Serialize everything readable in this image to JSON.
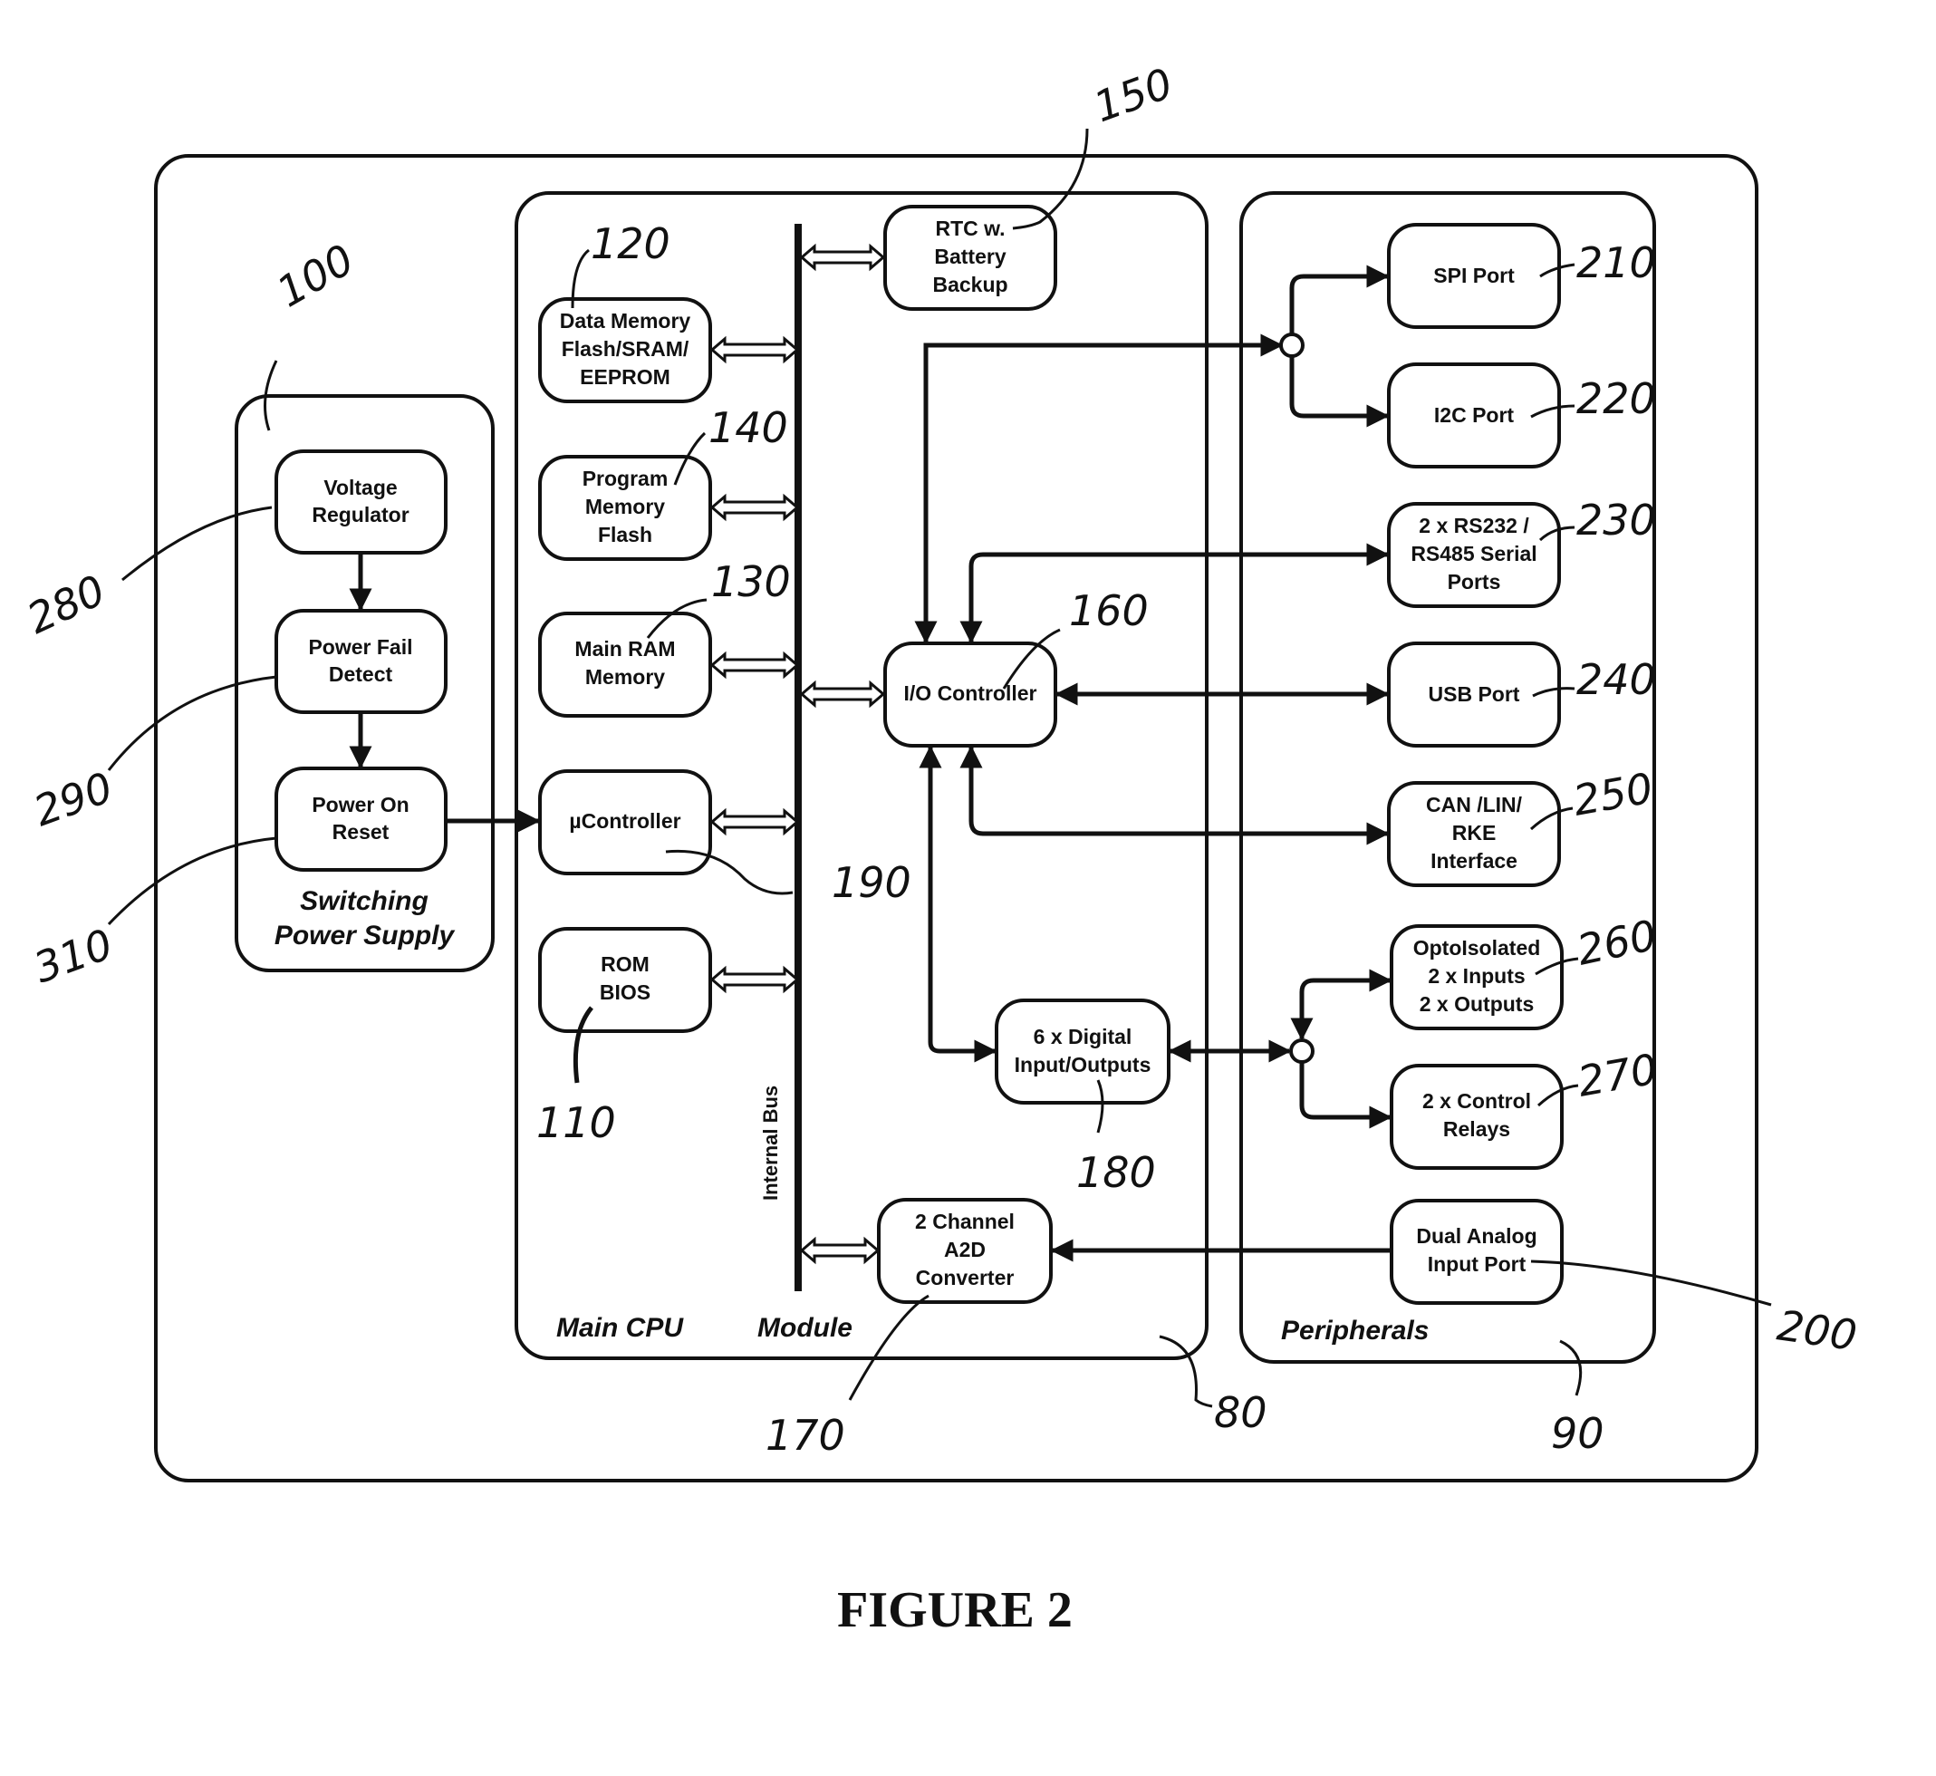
{
  "figure": {
    "caption": "FIGURE 2"
  },
  "groups": {
    "power_supply": {
      "label_line1": "Switching",
      "label_line2": "Power Supply",
      "ref": "100"
    },
    "cpu_module": {
      "label_left": "Main CPU",
      "label_right": "Module",
      "ref": "80"
    },
    "peripherals": {
      "label": "Peripherals",
      "ref": "90"
    }
  },
  "bus": {
    "label": "Internal Bus"
  },
  "blocks": {
    "voltage_regulator": {
      "lines": [
        "Voltage",
        "Regulator"
      ],
      "ref": "280"
    },
    "power_fail_detect": {
      "lines": [
        "Power Fail",
        "Detect"
      ],
      "ref": "290"
    },
    "power_on_reset": {
      "lines": [
        "Power On",
        "Reset"
      ],
      "ref": "310"
    },
    "data_memory": {
      "lines": [
        "Data Memory",
        "Flash/SRAM/",
        "EEPROM"
      ],
      "ref": "120"
    },
    "program_memory": {
      "lines": [
        "Program",
        "Memory",
        "Flash"
      ],
      "ref": "140"
    },
    "main_ram": {
      "lines": [
        "Main RAM",
        "Memory"
      ],
      "ref": "130"
    },
    "ucontroller": {
      "lines": [
        "µController"
      ],
      "ref": "190"
    },
    "rom_bios": {
      "lines": [
        "ROM",
        "BIOS"
      ],
      "ref": "110"
    },
    "rtc": {
      "lines": [
        "RTC w.",
        "Battery",
        "Backup"
      ],
      "ref": "150"
    },
    "io_controller": {
      "lines": [
        "I/O Controller"
      ],
      "ref": "160"
    },
    "digital_io": {
      "lines": [
        "6  x  Digital",
        "Input/Outputs"
      ],
      "ref": "180"
    },
    "a2d": {
      "lines": [
        "2 Channel",
        "A2D",
        "Converter"
      ],
      "ref": "170"
    },
    "spi": {
      "lines": [
        "SPI Port"
      ],
      "ref": "210"
    },
    "i2c": {
      "lines": [
        "I2C Port"
      ],
      "ref": "220"
    },
    "serial": {
      "lines": [
        "2 x RS232 /",
        "RS485 Serial",
        "Ports"
      ],
      "ref": "230"
    },
    "usb": {
      "lines": [
        "USB Port"
      ],
      "ref": "240"
    },
    "can": {
      "lines": [
        "CAN /LIN/",
        "RKE",
        "Interface"
      ],
      "ref": "250"
    },
    "opto": {
      "lines": [
        "OptoIsolated",
        "2 x Inputs",
        "2 x Outputs"
      ],
      "ref": "260"
    },
    "relays": {
      "lines": [
        "2 x Control",
        "Relays"
      ],
      "ref": "270"
    },
    "analog_in": {
      "lines": [
        "Dual Analog",
        "Input Port"
      ],
      "ref": "200"
    }
  }
}
